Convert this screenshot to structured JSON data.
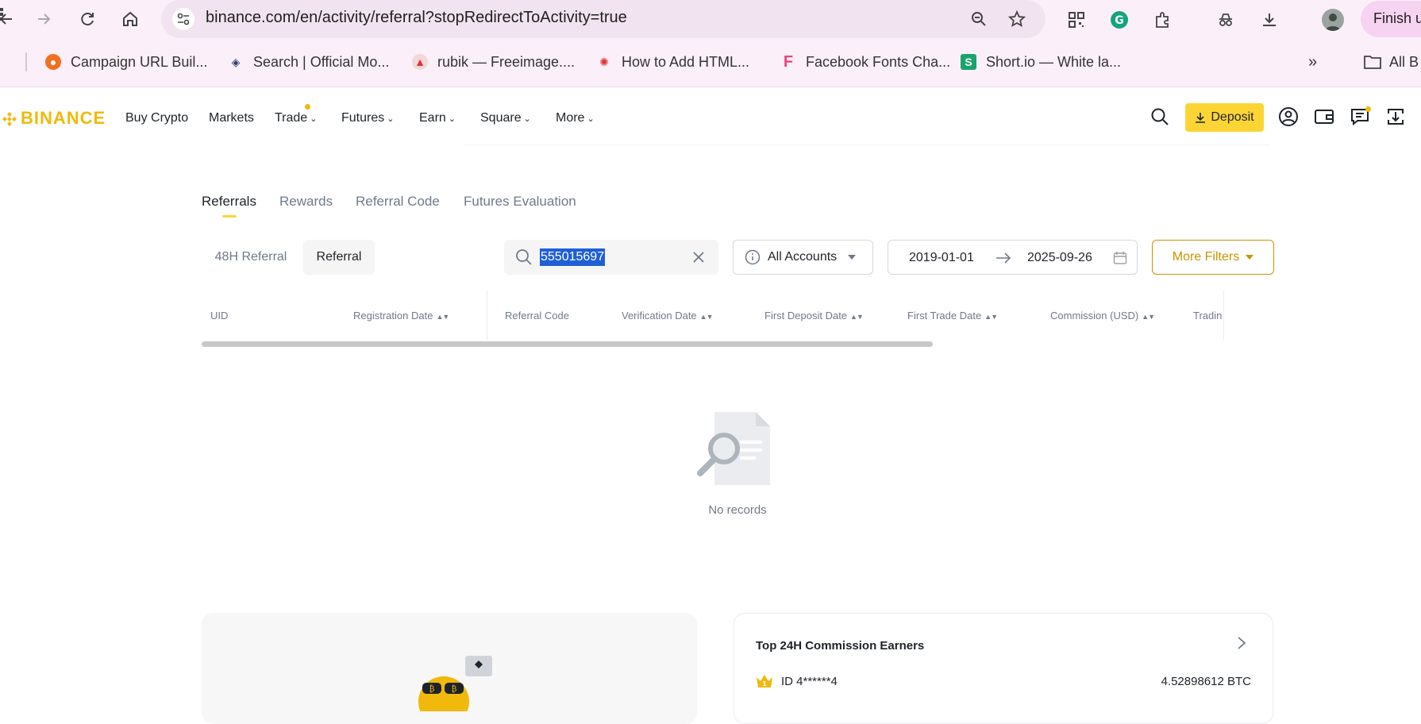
{
  "browser": {
    "url": "binance.com/en/activity/referral?stopRedirectToActivity=true",
    "finish_label": "Finish u",
    "bookmarks": [
      {
        "label": "Campaign URL Buil...",
        "icon": "campaign-url-builder-favicon"
      },
      {
        "label": "Search | Official Mo...",
        "icon": "search-official-favicon"
      },
      {
        "label": "rubik — Freeimage....",
        "icon": "freeimage-favicon"
      },
      {
        "label": "How to Add HTML...",
        "icon": "html-favicon"
      },
      {
        "label": "Facebook Fonts Cha...",
        "icon": "facebook-fonts-favicon"
      },
      {
        "label": "Short.io — White la...",
        "icon": "shortio-favicon"
      }
    ],
    "all_bookmarks_label": "All B"
  },
  "header": {
    "logo": "BINANCE",
    "menu": [
      {
        "label": "Buy Crypto",
        "has_chevron": false
      },
      {
        "label": "Markets",
        "has_chevron": false
      },
      {
        "label": "Trade",
        "has_chevron": true,
        "badge": true
      },
      {
        "label": "Futures",
        "has_chevron": true
      },
      {
        "label": "Earn",
        "has_chevron": true
      },
      {
        "label": "Square",
        "has_chevron": true
      },
      {
        "label": "More",
        "has_chevron": true
      }
    ],
    "deposit_label": "Deposit",
    "accent_color": "#fcd535",
    "brand_color": "#f0b90b"
  },
  "tabs": [
    {
      "label": "Referrals",
      "active": true
    },
    {
      "label": "Rewards",
      "active": false
    },
    {
      "label": "Referral Code",
      "active": false
    },
    {
      "label": "Futures Evaluation",
      "active": false
    }
  ],
  "filters": {
    "segments": [
      {
        "label": "48H Referral",
        "active": false
      },
      {
        "label": "Referral",
        "active": true
      }
    ],
    "search_value": "555015697",
    "account_select": "All Accounts",
    "date_start": "2019-01-01",
    "date_end": "2025-09-26",
    "more_filters_label": "More Filters"
  },
  "table": {
    "columns": [
      {
        "label": "UID",
        "sortable": false
      },
      {
        "label": "Registration Date",
        "sortable": true
      },
      {
        "label": "Referral Code",
        "sortable": false
      },
      {
        "label": "Verification Date",
        "sortable": true
      },
      {
        "label": "First Deposit Date",
        "sortable": true
      },
      {
        "label": "First Trade Date",
        "sortable": true
      },
      {
        "label": "Commission (USD)",
        "sortable": true
      },
      {
        "label": "Tradin",
        "sortable": false
      }
    ],
    "empty_text": "No records"
  },
  "top_earners": {
    "title": "Top 24H Commission Earners",
    "rows": [
      {
        "rank": "1",
        "id": "ID 4******4",
        "value": "4.52898612 BTC"
      }
    ]
  }
}
